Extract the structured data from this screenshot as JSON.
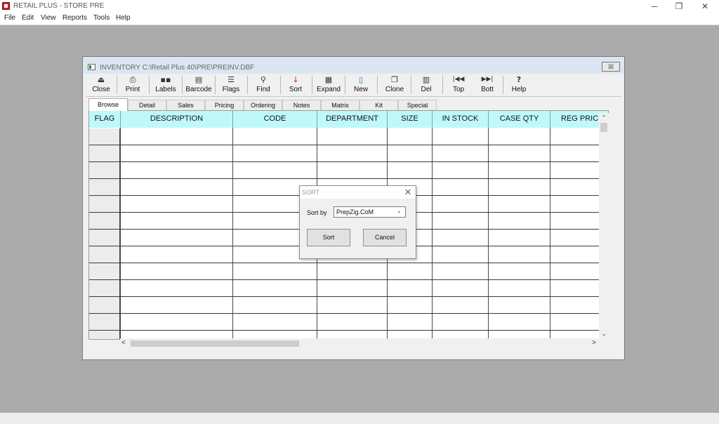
{
  "app": {
    "title": "RETAIL PLUS - STORE PRE"
  },
  "window_controls": {
    "minimize": "─",
    "restore": "❐",
    "close": "✕"
  },
  "menu": [
    "File",
    "Edit",
    "View",
    "Reports",
    "Tools",
    "Help"
  ],
  "inventory_window": {
    "title": "INVENTORY C:\\Retail Plus 40\\PRE\\PREINV.DBF",
    "close_glyph": "☒"
  },
  "toolbar": [
    {
      "label": "Close",
      "icon": "close-register-icon",
      "glyph": "⏏"
    },
    {
      "label": "Print",
      "icon": "printer-icon",
      "glyph": "⎙"
    },
    {
      "label": "Labels",
      "icon": "labels-icon",
      "glyph": "▪▪"
    },
    {
      "label": "Barcode",
      "icon": "barcode-icon",
      "glyph": "▤"
    },
    {
      "label": "Flags",
      "icon": "flags-list-icon",
      "glyph": "☰"
    },
    {
      "label": "Find",
      "icon": "magnifier-icon",
      "glyph": "⚲"
    },
    {
      "label": "Sort",
      "icon": "sort-az-icon",
      "glyph": "↓"
    },
    {
      "label": "Expand",
      "icon": "expand-grid-icon",
      "glyph": "▦"
    },
    {
      "label": "New",
      "icon": "new-document-icon",
      "glyph": "▯"
    },
    {
      "label": "Clone",
      "icon": "clone-icon",
      "glyph": "❐"
    },
    {
      "label": "Del",
      "icon": "trash-icon",
      "glyph": "▥"
    },
    {
      "label": "Top",
      "icon": "first-record-icon",
      "glyph": "|◀◀"
    },
    {
      "label": "Bott",
      "icon": "last-record-icon",
      "glyph": "▶▶|"
    },
    {
      "label": "Help",
      "icon": "help-icon",
      "glyph": "?"
    }
  ],
  "tabs": [
    "Browse",
    "Detail",
    "Sales",
    "Pricing",
    "Ordering",
    "Notes",
    "Matrix",
    "Kit",
    "Special"
  ],
  "active_tab": "Browse",
  "grid": {
    "columns": [
      "FLAG",
      "DESCRIPTION",
      "CODE",
      "DEPARTMENT",
      "SIZE",
      "IN STOCK",
      "CASE QTY",
      "REG PRICE"
    ],
    "header_color": "#bff8fb",
    "rows": []
  },
  "scrollbars": {
    "up": "⌃",
    "down": "⌄",
    "left": "<",
    "right": ">"
  },
  "sort_dialog": {
    "title": "SORT",
    "close_glyph": "✕",
    "sort_by_label": "Sort by",
    "sort_by_value": "PrepZig.CoM",
    "chevron": "⌄",
    "sort_button": "Sort",
    "cancel_button": "Cancel"
  }
}
